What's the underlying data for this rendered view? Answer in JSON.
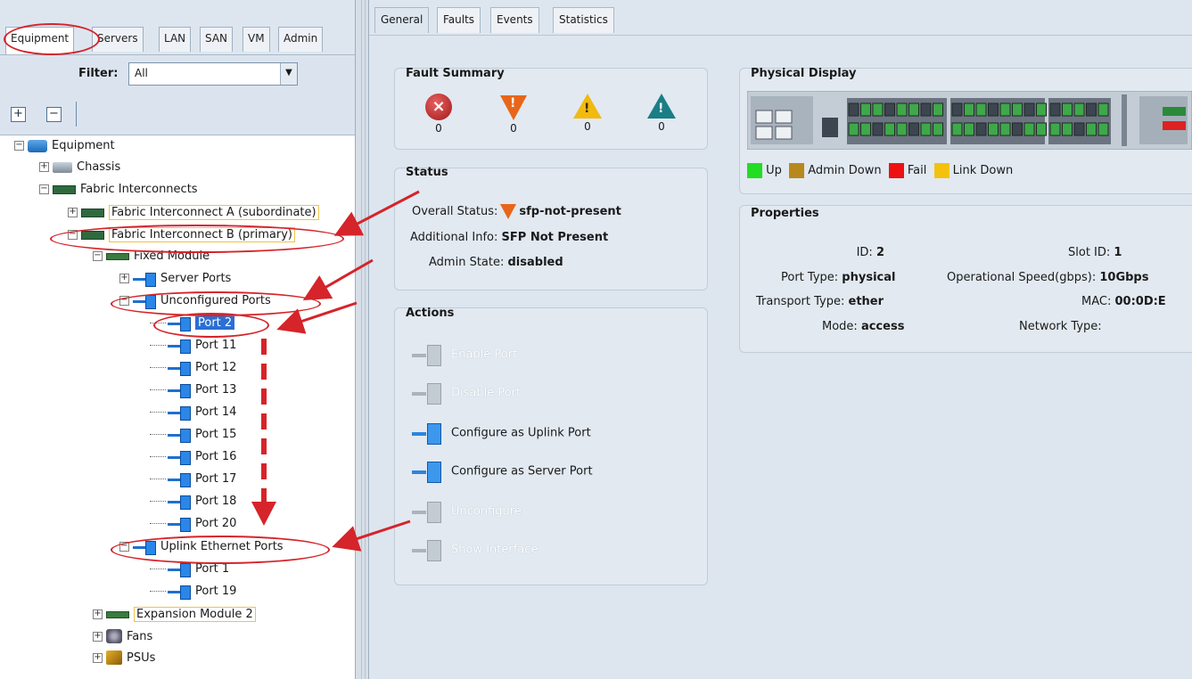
{
  "left_tabs": [
    "Equipment",
    "Servers",
    "LAN",
    "SAN",
    "VM",
    "Admin"
  ],
  "filter": {
    "label": "Filter:",
    "value": "All"
  },
  "toolbar": {
    "expand_all": "+",
    "collapse_all": "−"
  },
  "tree": {
    "equipment": "Equipment",
    "chassis": "Chassis",
    "fabric_interconnects": "Fabric Interconnects",
    "fi_a": "Fabric Interconnect A (subordinate)",
    "fi_b": "Fabric Interconnect B (primary)",
    "fixed_module": "Fixed Module",
    "server_ports": "Server Ports",
    "unconfigured_ports": "Unconfigured Ports",
    "unconfigured_list": [
      "Port 2",
      "Port 11",
      "Port 12",
      "Port 13",
      "Port 14",
      "Port 15",
      "Port 16",
      "Port 17",
      "Port 18",
      "Port 20"
    ],
    "uplink_ports": "Uplink Ethernet Ports",
    "uplink_list": [
      "Port 1",
      "Port 19"
    ],
    "expansion_module": "Expansion Module 2",
    "fans": "Fans",
    "psus": "PSUs"
  },
  "right_tabs": [
    "General",
    "Faults",
    "Events",
    "Statistics"
  ],
  "fault_summary": {
    "title": "Fault Summary",
    "critical": "0",
    "major": "0",
    "minor": "0",
    "warning": "0"
  },
  "status": {
    "title": "Status",
    "overall_label": "Overall Status:",
    "overall_value": "sfp-not-present",
    "additional_label": "Additional Info:",
    "additional_value": "SFP Not Present",
    "admin_label": "Admin State:",
    "admin_value": "disabled"
  },
  "actions": {
    "title": "Actions",
    "enable_port": "Enable Port",
    "disable_port": "Disable Port",
    "configure_uplink": "Configure as Uplink Port",
    "configure_server": "Configure as Server Port",
    "unconfigure": "Unconfigure",
    "show_interface": "Show Interface"
  },
  "physical_display": {
    "title": "Physical Display",
    "legend": [
      {
        "label": "Up",
        "color": "#22dd22"
      },
      {
        "label": "Admin Down",
        "color": "#b8891a"
      },
      {
        "label": "Fail",
        "color": "#ee1111"
      },
      {
        "label": "Link Down",
        "color": "#f4c20d"
      }
    ]
  },
  "properties": {
    "title": "Properties",
    "id_label": "ID:",
    "id_value": "2",
    "slot_label": "Slot ID:",
    "slot_value": "1",
    "port_type_label": "Port Type:",
    "port_type_value": "physical",
    "speed_label": "Operational Speed(gbps):",
    "speed_value": "10Gbps",
    "transport_label": "Transport Type:",
    "transport_value": "ether",
    "mac_label": "MAC:",
    "mac_value": "00:0D:E",
    "mode_label": "Mode:",
    "mode_value": "access",
    "network_label": "Network Type:",
    "network_value": ""
  }
}
